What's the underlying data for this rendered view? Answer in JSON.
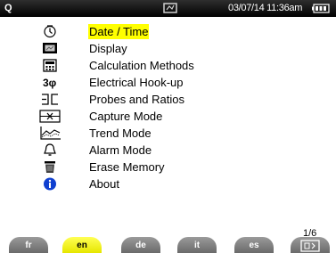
{
  "status_bar": {
    "logo": "Q",
    "datetime": "03/07/14  11:36am"
  },
  "menu": {
    "items": [
      {
        "label": "Date / Time",
        "icon": "clock-icon",
        "selected": true
      },
      {
        "label": "Display",
        "icon": "display-icon",
        "selected": false
      },
      {
        "label": "Calculation Methods",
        "icon": "calculator-icon",
        "selected": false
      },
      {
        "label": "Electrical Hook-up",
        "icon": "three-phase-icon",
        "selected": false
      },
      {
        "label": "Probes and Ratios",
        "icon": "probe-icon",
        "selected": false
      },
      {
        "label": "Capture Mode",
        "icon": "capture-icon",
        "selected": false
      },
      {
        "label": "Trend Mode",
        "icon": "trend-icon",
        "selected": false
      },
      {
        "label": "Alarm Mode",
        "icon": "bell-icon",
        "selected": false
      },
      {
        "label": "Erase Memory",
        "icon": "trash-icon",
        "selected": false
      },
      {
        "label": "About",
        "icon": "info-icon",
        "selected": false
      }
    ]
  },
  "page_counter": "1/6",
  "tabs": [
    {
      "label": "fr",
      "active": false
    },
    {
      "label": "en",
      "active": true
    },
    {
      "label": "de",
      "active": false
    },
    {
      "label": "it",
      "active": false
    },
    {
      "label": "es",
      "active": false
    }
  ],
  "colors": {
    "selection": "#ffff00",
    "info_blue": "#1040d0",
    "status_bar": "#000000",
    "tab": "#808080"
  }
}
